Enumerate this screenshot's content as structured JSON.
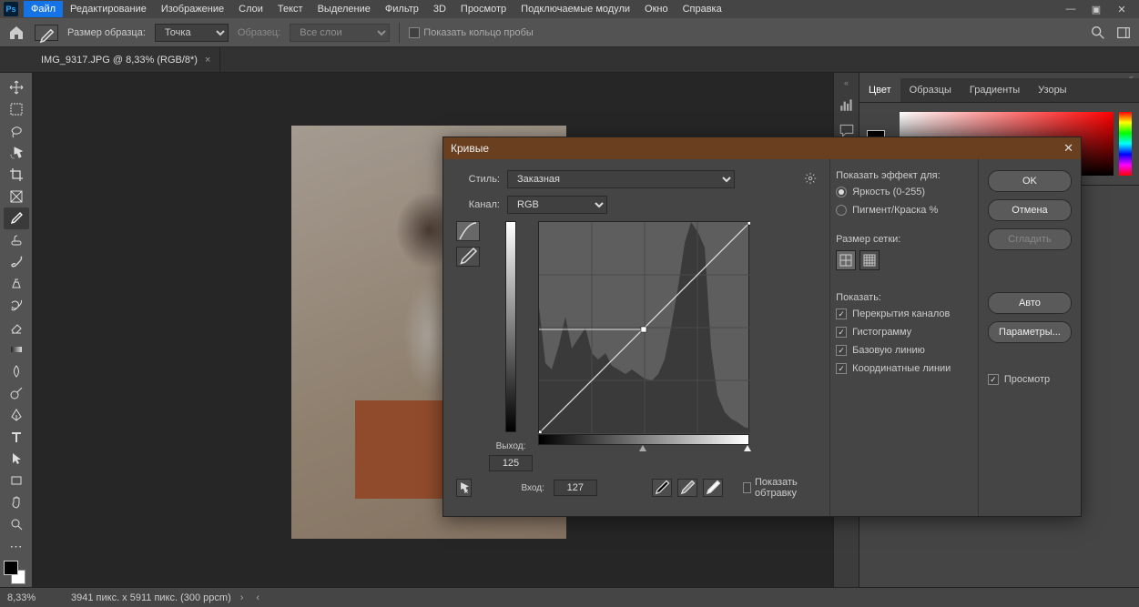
{
  "menubar": {
    "items": [
      "Файл",
      "Редактирование",
      "Изображение",
      "Слои",
      "Текст",
      "Выделение",
      "Фильтр",
      "3D",
      "Просмотр",
      "Подключаемые модули",
      "Окно",
      "Справка"
    ]
  },
  "options": {
    "sample_size_label": "Размер образца:",
    "sample_size_value": "Точка",
    "sample_label": "Образец:",
    "sample_value": "Все слои",
    "show_ring_label": "Показать кольцо пробы"
  },
  "doctab": {
    "label": "IMG_9317.JPG @ 8,33% (RGB/8*)"
  },
  "panels": {
    "tabs": [
      "Цвет",
      "Образцы",
      "Градиенты",
      "Узоры"
    ]
  },
  "statusbar": {
    "zoom": "8,33%",
    "info": "3941 пикс. x 5911 пикс. (300 ppcm)"
  },
  "dialog": {
    "title": "Кривые",
    "style_label": "Стиль:",
    "style_value": "Заказная",
    "channel_label": "Канал:",
    "channel_value": "RGB",
    "output_label": "Выход:",
    "output_value": "125",
    "input_label": "Вход:",
    "input_value": "127",
    "show_clip": "Показать обтравку",
    "show_effect_label": "Показать эффект для:",
    "radio_brightness": "Яркость (0-255)",
    "radio_pigment": "Пигмент/Краска %",
    "grid_label": "Размер сетки:",
    "show_label": "Показать:",
    "check_overlay": "Перекрытия каналов",
    "check_histogram": "Гистограмму",
    "check_baseline": "Базовую линию",
    "check_intersection": "Координатные линии",
    "check_preview": "Просмотр",
    "btn_ok": "OK",
    "btn_cancel": "Отмена",
    "btn_smooth": "Сгладить",
    "btn_auto": "Авто",
    "btn_options": "Параметры..."
  },
  "chart_data": {
    "type": "line",
    "title": "Кривые (Curves)",
    "xlabel": "Вход",
    "ylabel": "Выход",
    "xlim": [
      0,
      255
    ],
    "ylim": [
      0,
      255
    ],
    "series": [
      {
        "name": "RGB curve",
        "x": [
          0,
          127,
          255
        ],
        "y": [
          0,
          125,
          255
        ]
      }
    ],
    "histogram": {
      "bins_x": [
        0,
        8,
        16,
        24,
        32,
        40,
        48,
        56,
        64,
        72,
        80,
        88,
        96,
        104,
        112,
        120,
        128,
        136,
        144,
        152,
        160,
        168,
        176,
        184,
        192,
        200,
        208,
        216,
        224,
        232,
        240,
        248,
        255
      ],
      "counts_norm": [
        0.6,
        0.33,
        0.3,
        0.42,
        0.55,
        0.4,
        0.45,
        0.5,
        0.38,
        0.35,
        0.38,
        0.32,
        0.3,
        0.28,
        0.3,
        0.28,
        0.26,
        0.25,
        0.28,
        0.35,
        0.5,
        0.7,
        0.9,
        1.0,
        0.95,
        0.88,
        0.4,
        0.18,
        0.1,
        0.07,
        0.05,
        0.03,
        0.02
      ]
    }
  }
}
